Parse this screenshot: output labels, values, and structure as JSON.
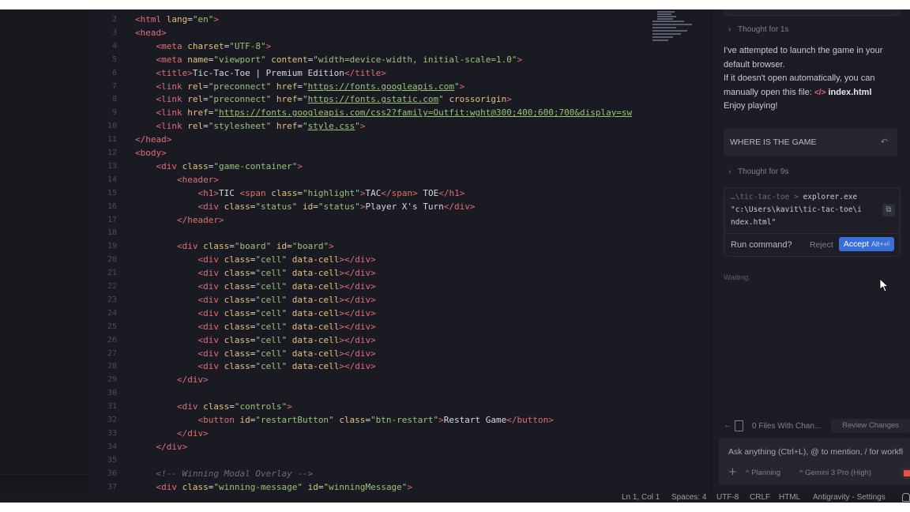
{
  "editor": {
    "lines": [
      {
        "n": "2",
        "html": "<span class='tag'>&lt;html</span> <span class='attr'>lang</span>=<span class='str'>\"en\"</span><span class='tag'>&gt;</span>"
      },
      {
        "n": "3",
        "html": "<span class='tag'>&lt;head&gt;</span>"
      },
      {
        "n": "4",
        "html": "    <span class='tag'>&lt;meta</span> <span class='attr'>charset</span>=<span class='str'>\"UTF-8\"</span><span class='tag'>&gt;</span>"
      },
      {
        "n": "5",
        "html": "    <span class='tag'>&lt;meta</span> <span class='attr'>name</span>=<span class='str'>\"viewport\"</span> <span class='attr'>content</span>=<span class='str'>\"width=device-width, initial-scale=1.0\"</span><span class='tag'>&gt;</span>"
      },
      {
        "n": "6",
        "html": "    <span class='tag'>&lt;title&gt;</span>Tic-Tac-Toe | Premium Edition<span class='tag'>&lt;/title&gt;</span>"
      },
      {
        "n": "7",
        "html": "    <span class='tag'>&lt;link</span> <span class='attr'>rel</span>=<span class='str'>\"preconnect\"</span> <span class='attr'>href</span>=<span class='str'>\"</span><span class='link'>https://fonts.googleapis.com</span><span class='str'>\"</span><span class='tag'>&gt;</span>"
      },
      {
        "n": "8",
        "html": "    <span class='tag'>&lt;link</span> <span class='attr'>rel</span>=<span class='str'>\"preconnect\"</span> <span class='attr'>href</span>=<span class='str'>\"</span><span class='link'>https://fonts.gstatic.com</span><span class='str'>\"</span> <span class='attr'>crossorigin</span><span class='tag'>&gt;</span>"
      },
      {
        "n": "9",
        "html": "    <span class='tag'>&lt;link</span> <span class='attr'>href</span>=<span class='str'>\"</span><span class='link'>https://fonts.googleapis.com/css2?family=Outfit:wght@300;400;600;700&amp;display=sw</span>"
      },
      {
        "n": "10",
        "html": "    <span class='tag'>&lt;link</span> <span class='attr'>rel</span>=<span class='str'>\"stylesheet\"</span> <span class='attr'>href</span>=<span class='str'>\"</span><span class='link'>style.css</span><span class='str'>\"</span><span class='tag'>&gt;</span>"
      },
      {
        "n": "11",
        "html": "<span class='tag'>&lt;/head&gt;</span>"
      },
      {
        "n": "12",
        "html": "<span class='tag'>&lt;body&gt;</span>"
      },
      {
        "n": "13",
        "html": "    <span class='tag'>&lt;div</span> <span class='attr'>class</span>=<span class='str'>\"game-container\"</span><span class='tag'>&gt;</span>"
      },
      {
        "n": "14",
        "html": "        <span class='tag'>&lt;header&gt;</span>"
      },
      {
        "n": "15",
        "html": "            <span class='tag'>&lt;h1&gt;</span>TIC <span class='tag'>&lt;span</span> <span class='attr'>class</span>=<span class='str'>\"highlight\"</span><span class='tag'>&gt;</span>TAC<span class='tag'>&lt;/span&gt;</span> TOE<span class='tag'>&lt;/h1&gt;</span>"
      },
      {
        "n": "16",
        "html": "            <span class='tag'>&lt;div</span> <span class='attr'>class</span>=<span class='str'>\"status\"</span> <span class='attr'>id</span>=<span class='str'>\"status\"</span><span class='tag'>&gt;</span>Player X's Turn<span class='tag'>&lt;/div&gt;</span>"
      },
      {
        "n": "17",
        "html": "        <span class='tag'>&lt;/header&gt;</span>"
      },
      {
        "n": "18",
        "html": ""
      },
      {
        "n": "19",
        "html": "        <span class='tag'>&lt;div</span> <span class='attr'>class</span>=<span class='str'>\"board\"</span> <span class='attr'>id</span>=<span class='str'>\"board\"</span><span class='tag'>&gt;</span>"
      },
      {
        "n": "20",
        "html": "            <span class='tag'>&lt;div</span> <span class='attr'>class</span>=<span class='str'>\"cell\"</span> <span class='attr'>data-cell</span><span class='tag'>&gt;&lt;/div&gt;</span>"
      },
      {
        "n": "21",
        "html": "            <span class='tag'>&lt;div</span> <span class='attr'>class</span>=<span class='str'>\"cell\"</span> <span class='attr'>data-cell</span><span class='tag'>&gt;&lt;/div&gt;</span>"
      },
      {
        "n": "22",
        "html": "            <span class='tag'>&lt;div</span> <span class='attr'>class</span>=<span class='str'>\"cell\"</span> <span class='attr'>data-cell</span><span class='tag'>&gt;&lt;/div&gt;</span>"
      },
      {
        "n": "23",
        "html": "            <span class='tag'>&lt;div</span> <span class='attr'>class</span>=<span class='str'>\"cell\"</span> <span class='attr'>data-cell</span><span class='tag'>&gt;&lt;/div&gt;</span>"
      },
      {
        "n": "24",
        "html": "            <span class='tag'>&lt;div</span> <span class='attr'>class</span>=<span class='str'>\"cell\"</span> <span class='attr'>data-cell</span><span class='tag'>&gt;&lt;/div&gt;</span>"
      },
      {
        "n": "25",
        "html": "            <span class='tag'>&lt;div</span> <span class='attr'>class</span>=<span class='str'>\"cell\"</span> <span class='attr'>data-cell</span><span class='tag'>&gt;&lt;/div&gt;</span>"
      },
      {
        "n": "26",
        "html": "            <span class='tag'>&lt;div</span> <span class='attr'>class</span>=<span class='str'>\"cell\"</span> <span class='attr'>data-cell</span><span class='tag'>&gt;&lt;/div&gt;</span>"
      },
      {
        "n": "27",
        "html": "            <span class='tag'>&lt;div</span> <span class='attr'>class</span>=<span class='str'>\"cell\"</span> <span class='attr'>data-cell</span><span class='tag'>&gt;&lt;/div&gt;</span>"
      },
      {
        "n": "28",
        "html": "            <span class='tag'>&lt;div</span> <span class='attr'>class</span>=<span class='str'>\"cell\"</span> <span class='attr'>data-cell</span><span class='tag'>&gt;&lt;/div&gt;</span>"
      },
      {
        "n": "29",
        "html": "        <span class='tag'>&lt;/div&gt;</span>"
      },
      {
        "n": "30",
        "html": ""
      },
      {
        "n": "31",
        "html": "        <span class='tag'>&lt;div</span> <span class='attr'>class</span>=<span class='str'>\"controls\"</span><span class='tag'>&gt;</span>"
      },
      {
        "n": "32",
        "html": "            <span class='tag'>&lt;button</span> <span class='attr'>id</span>=<span class='str'>\"restartButton\"</span> <span class='attr'>class</span>=<span class='str'>\"btn-restart\"</span><span class='tag'>&gt;</span>Restart Game<span class='tag'>&lt;/button&gt;</span>"
      },
      {
        "n": "33",
        "html": "        <span class='tag'>&lt;/div&gt;</span>"
      },
      {
        "n": "34",
        "html": "    <span class='tag'>&lt;/div&gt;</span>"
      },
      {
        "n": "35",
        "html": ""
      },
      {
        "n": "36",
        "html": "    <span class='com'>&lt;!-- Winning Modal Overlay --&gt;</span>"
      },
      {
        "n": "37",
        "html": "    <span class='tag'>&lt;div</span> <span class='attr'>class</span>=<span class='str'>\"winning-message\"</span> <span class='attr'>id</span>=<span class='str'>\"winningMessage\"</span><span class='tag'>&gt;</span>"
      }
    ]
  },
  "panel": {
    "thought1": "Thought for 1s",
    "msg_line1": "I've attempted to launch the game in your default browser.",
    "msg_line2": "If it doesn't open automatically, you can manually open this file:",
    "msg_file_icon": "</>",
    "msg_file": "index.html",
    "msg_line3": "Enjoy playing!",
    "user_prompt": "WHERE IS THE GAME",
    "undo_icon": "↶",
    "thought2": "Thought for 9s",
    "command_prefix": "…\\tic-tac-toe > ",
    "command_line1": "explorer.exe",
    "command_line2": "\"c:\\Users\\kavit\\tic-tac-toe\\i",
    "command_line3": "ndex.html\"",
    "run_label": "Run command?",
    "reject_label": "Reject",
    "accept_label": "Accept",
    "accept_shortcut": "Alt+⏎",
    "waiting": "Waiting.",
    "files_changed": "0 Files With Chan...",
    "review_changes": "Review Changes",
    "input_placeholder": "Ask anything (Ctrl+L), @ to mention, / for workfl",
    "mode": "Planning",
    "model": "Gemini 3 Pro (High)"
  },
  "status": {
    "position": "Ln 1, Col 1",
    "spaces": "Spaces: 4",
    "encoding": "UTF-8",
    "eol": "CRLF",
    "language": "HTML",
    "settings": "Antigravity - Settings"
  }
}
